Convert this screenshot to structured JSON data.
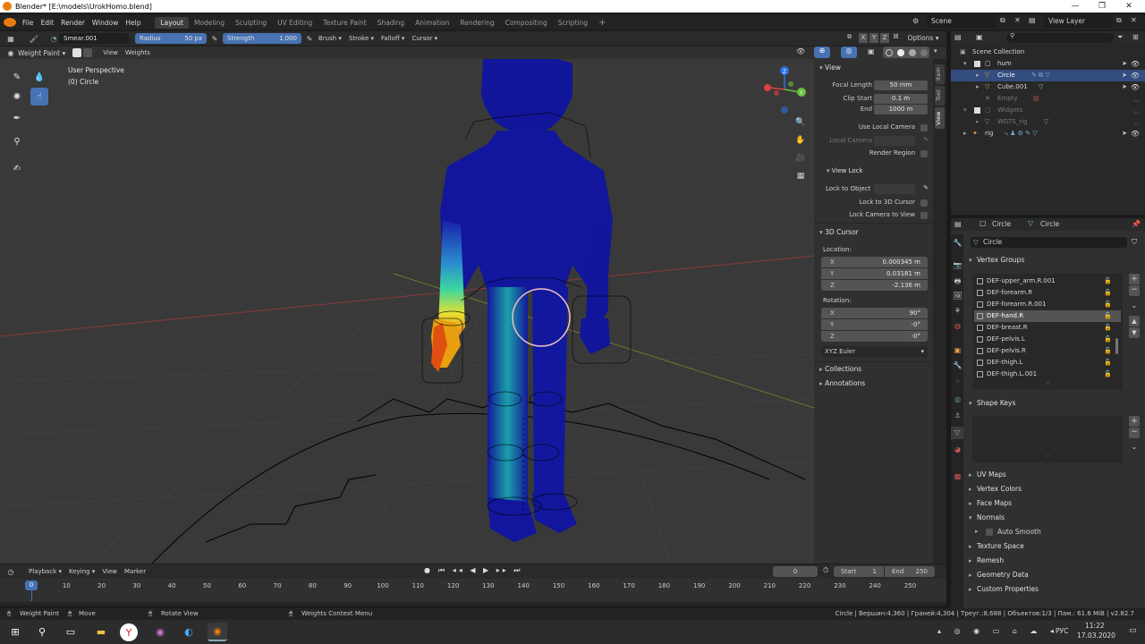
{
  "window": {
    "title": "Blender* [E:\\models\\UrokHomo.blend]",
    "controls": [
      "—",
      "❐",
      "✕"
    ]
  },
  "menu": {
    "items": [
      "File",
      "Edit",
      "Render",
      "Window",
      "Help"
    ],
    "workspaces": [
      "Layout",
      "Modeling",
      "Sculpting",
      "UV Editing",
      "Texture Paint",
      "Shading",
      "Animation",
      "Rendering",
      "Compositing",
      "Scripting"
    ],
    "add_tab": "+",
    "scene_label": "Scene",
    "view_layer_label": "View Layer"
  },
  "tool_header": {
    "brush_name": "Smear.001",
    "radius_label": "Radius",
    "radius_value": "50 px",
    "strength_label": "Strength",
    "strength_value": "1.000",
    "menus": [
      "Brush",
      "Stroke",
      "Falloff",
      "Cursor"
    ],
    "xyz": [
      "X",
      "Y",
      "Z"
    ],
    "options": "Options"
  },
  "mode_header": {
    "mode": "Weight Paint",
    "menus": [
      "View",
      "Weights"
    ]
  },
  "viewport": {
    "perspective": "User Perspective",
    "object": "(0) Circle",
    "gizmo_axes": [
      "X",
      "Y",
      "Z"
    ]
  },
  "n_panel": {
    "tabs": [
      "Item",
      "Tool",
      "View"
    ],
    "view_title": "View",
    "focal_length_label": "Focal Length",
    "focal_length": "50 mm",
    "clip_start_label": "Clip Start",
    "clip_start": "0.1 m",
    "end_label": "End",
    "end": "1000 m",
    "use_local_camera": "Use Local Camera",
    "local_camera": "Local Camera",
    "render_region": "Render Region",
    "view_lock_title": "View Lock",
    "lock_to_object": "Lock to Object",
    "lock_to_3d_cursor": "Lock to 3D Cursor",
    "lock_camera_to_view": "Lock Camera to View",
    "cursor_title": "3D Cursor",
    "location_label": "Location:",
    "loc_x": "0.000345 m",
    "loc_y": "0.03181 m",
    "loc_z": "-2.136 m",
    "rotation_label": "Rotation:",
    "rot_x": "90°",
    "rot_y": "-0°",
    "rot_z": "-0°",
    "rotation_mode": "XYZ Euler",
    "collections": "Collections",
    "annotations": "Annotations"
  },
  "outliner": {
    "search_placeholder": "",
    "rows": [
      {
        "name": "Scene Collection",
        "indent": 0
      },
      {
        "name": "hum",
        "indent": 1
      },
      {
        "name": "Circle",
        "indent": 2,
        "selected": true
      },
      {
        "name": "Cube.001",
        "indent": 2
      },
      {
        "name": "Empty",
        "indent": 2,
        "dim": true
      },
      {
        "name": "Widgets",
        "indent": 1,
        "dim": true
      },
      {
        "name": "WGTS_rig",
        "indent": 2,
        "dim": true
      },
      {
        "name": "rig",
        "indent": 1
      }
    ]
  },
  "properties": {
    "breadcrumb_object": "Circle",
    "breadcrumb_data": "Circle",
    "data_name": "Circle",
    "vertex_groups_title": "Vertex Groups",
    "vertex_groups": [
      "DEF-upper_arm.R.001",
      "DEF-forearm.R",
      "DEF-forearm.R.001",
      "DEF-hand.R",
      "DEF-breast.R",
      "DEF-pelvis.L",
      "DEF-pelvis.R",
      "DEF-thigh.L",
      "DEF-thigh.L.001"
    ],
    "selected_group": "DEF-hand.R",
    "shape_keys_title": "Shape Keys",
    "panels": [
      "UV Maps",
      "Vertex Colors",
      "Face Maps",
      "Normals",
      "Texture Space",
      "Remesh",
      "Geometry Data",
      "Custom Properties"
    ],
    "auto_smooth": "Auto Smooth"
  },
  "timeline": {
    "menus": [
      "Playback",
      "Keying",
      "View",
      "Marker"
    ],
    "current_frame": "0",
    "start_label": "Start",
    "start": "1",
    "end_label": "End",
    "end": "250",
    "ticks": [
      "0",
      "10",
      "20",
      "30",
      "40",
      "50",
      "60",
      "70",
      "80",
      "90",
      "100",
      "110",
      "120",
      "130",
      "140",
      "150",
      "160",
      "170",
      "180",
      "190",
      "200",
      "210",
      "220",
      "230",
      "240",
      "250"
    ],
    "indicator": "0"
  },
  "statusbar": {
    "left1": "Weight Paint",
    "left2": "Move",
    "left3": "Rotate View",
    "left4": "Weights Context Menu",
    "right": "Circle | Вершин:4,360 | Граней:4,304 | Треуг.:8,688 | Объектов:1/3 | Пам.: 61.6 MiB | v2.82.7"
  },
  "taskbar": {
    "lang": "РУС",
    "time": "11:22",
    "date": "17.03.2020"
  }
}
